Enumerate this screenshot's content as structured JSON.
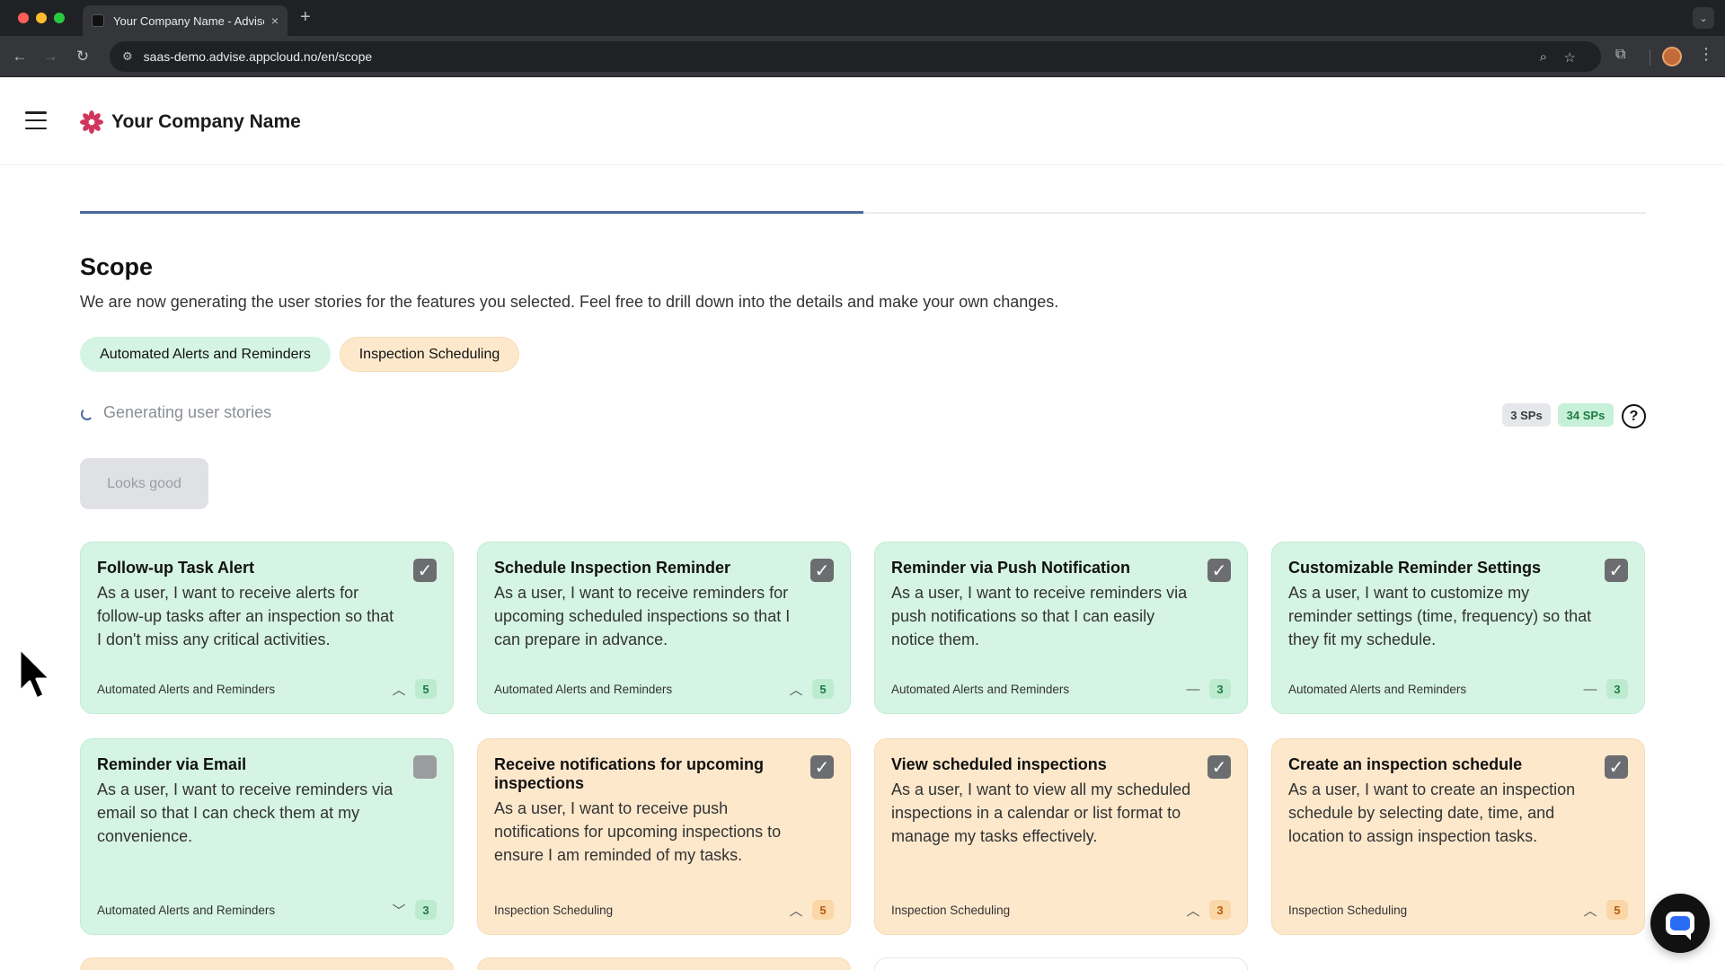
{
  "browser": {
    "tab_title": "Your Company Name - Advise",
    "tab_close": "×",
    "new_tab": "+",
    "url": "saas-demo.advise.appcloud.no/en/scope"
  },
  "header": {
    "company_name": "Your Company Name"
  },
  "progress": {
    "fraction": 0.5
  },
  "page": {
    "title": "Scope",
    "description": "We are now generating the user stories for the features you selected. Feel free to drill down into the details and make your own changes."
  },
  "feature_chips": [
    {
      "label": "Automated Alerts and Reminders",
      "color": "#d5f4e3"
    },
    {
      "label": "Inspection Scheduling",
      "color": "#fde8cc"
    }
  ],
  "status": {
    "generating_text": "Generating user stories",
    "sp_grey": "3 SPs",
    "sp_green": "34 SPs",
    "help": "?"
  },
  "actions": {
    "looks_good": "Looks good"
  },
  "cards": [
    {
      "title": "Follow-up Task Alert",
      "body": "As a user, I want to receive alerts for follow-up tasks after an inspection so that I don't miss any critical activities.",
      "tag": "Automated Alerts and Reminders",
      "trend": "^",
      "points": "5",
      "checked": true,
      "theme": "green"
    },
    {
      "title": "Schedule Inspection Reminder",
      "body": "As a user, I want to receive reminders for upcoming scheduled inspections so that I can prepare in advance.",
      "tag": "Automated Alerts and Reminders",
      "trend": "^",
      "points": "5",
      "checked": true,
      "theme": "green"
    },
    {
      "title": "Reminder via Push Notification",
      "body": "As a user, I want to receive reminders via push notifications so that I can easily notice them.",
      "tag": "Automated Alerts and Reminders",
      "trend": "—",
      "points": "3",
      "checked": true,
      "theme": "green"
    },
    {
      "title": "Customizable Reminder Settings",
      "body": "As a user, I want to customize my reminder settings (time, frequency) so that they fit my schedule.",
      "tag": "Automated Alerts and Reminders",
      "trend": "—",
      "points": "3",
      "checked": true,
      "theme": "green"
    },
    {
      "title": "Reminder via Email",
      "body": "As a user, I want to receive reminders via email so that I can check them at my convenience.",
      "tag": "Automated Alerts and Reminders",
      "trend": "v",
      "points": "3",
      "checked": false,
      "theme": "green"
    },
    {
      "title": "Receive notifications for upcoming inspections",
      "body": "As a user, I want to receive push notifications for upcoming inspections to ensure I am reminded of my tasks.",
      "tag": "Inspection Scheduling",
      "trend": "^",
      "points": "5",
      "checked": true,
      "theme": "orange"
    },
    {
      "title": "View scheduled inspections",
      "body": "As a user, I want to view all my scheduled inspections in a calendar or list format to manage my tasks effectively.",
      "tag": "Inspection Scheduling",
      "trend": "^",
      "points": "3",
      "checked": true,
      "theme": "orange"
    },
    {
      "title": "Create an inspection schedule",
      "body": "As a user, I want to create an inspection schedule by selecting date, time, and location to assign inspection tasks.",
      "tag": "Inspection Scheduling",
      "trend": "^",
      "points": "5",
      "checked": true,
      "theme": "orange"
    }
  ],
  "colors": {
    "green_card": "#d5f4e3",
    "orange_card": "#fde8cc",
    "progress_accent": "#4b6a9b"
  }
}
